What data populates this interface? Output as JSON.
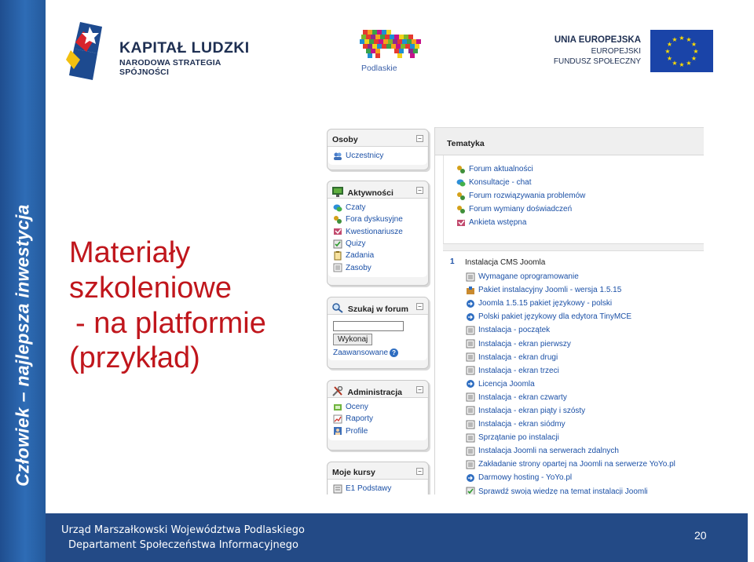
{
  "slide": {
    "vertical_slogan": "Człowiek – najlepsza inwestycja",
    "title_lines": [
      "Materiały",
      "szkoleniowe",
      "- na platformie",
      "(przykład)"
    ],
    "page_number": "20"
  },
  "logos": {
    "kapital": {
      "title": "KAPITAŁ LUDZKI",
      "subtitle": "NARODOWA STRATEGIA SPÓJNOŚCI"
    },
    "region": {
      "label": "Podlaskie"
    },
    "eu": {
      "line1": "UNIA EUROPEJSKA",
      "line2": "EUROPEJSKI",
      "line3": "FUNDUSZ SPOŁECZNY"
    }
  },
  "footer": {
    "line1": "Urząd Marszałkowski Województwa Podlaskiego",
    "line2": "Departament Społeczeństwa Informacyjnego"
  },
  "moodle": {
    "people": {
      "title": "Osoby",
      "items": [
        {
          "label": "Uczestnicy",
          "icon": "users-icon"
        }
      ]
    },
    "activities": {
      "title": "Aktywności",
      "items": [
        {
          "label": "Czaty",
          "icon": "chat-icon"
        },
        {
          "label": "Fora dyskusyjne",
          "icon": "forum-icon"
        },
        {
          "label": "Kwestionariusze",
          "icon": "questionnaire-icon"
        },
        {
          "label": "Quizy",
          "icon": "quiz-icon"
        },
        {
          "label": "Zadania",
          "icon": "assignment-icon"
        },
        {
          "label": "Zasoby",
          "icon": "resource-icon"
        }
      ]
    },
    "search": {
      "title": "Szukaj w forum",
      "button": "Wykonaj",
      "advanced": "Zaawansowane",
      "query": ""
    },
    "admin": {
      "title": "Administracja",
      "items": [
        {
          "label": "Oceny",
          "icon": "grades-icon"
        },
        {
          "label": "Raporty",
          "icon": "reports-icon"
        },
        {
          "label": "Profile",
          "icon": "profile-icon"
        }
      ]
    },
    "courses": {
      "title": "Moje kursy",
      "items": [
        {
          "label": "E1 Podstawy",
          "icon": "course-icon"
        }
      ]
    },
    "topics": {
      "title": "Tematyka",
      "items": [
        {
          "label": "Forum aktualności",
          "icon": "forum-icon"
        },
        {
          "label": "Konsultacje - chat",
          "icon": "chat-icon"
        },
        {
          "label": "Forum rozwiązywania problemów",
          "icon": "forum-icon"
        },
        {
          "label": "Forum wymiany doświadczeń",
          "icon": "forum-icon"
        },
        {
          "label": "Ankieta wstępna",
          "icon": "survey-icon"
        }
      ]
    },
    "section1": {
      "number": "1",
      "title": "Instalacja CMS Joomla",
      "items": [
        {
          "label": "Wymagane oprogramowanie",
          "icon": "page-icon"
        },
        {
          "label": "Pakiet instalacyjny Joomli - wersja 1.5.15",
          "icon": "package-icon"
        },
        {
          "label": "Joomla 1.5.15 pakiet językowy - polski",
          "icon": "link-icon"
        },
        {
          "label": "Polski pakiet językowy dla edytora TinyMCE",
          "icon": "link-icon"
        },
        {
          "label": "Instalacja - początek",
          "icon": "page-icon"
        },
        {
          "label": "Instalacja - ekran pierwszy",
          "icon": "page-icon"
        },
        {
          "label": "Instalacja - ekran drugi",
          "icon": "page-icon"
        },
        {
          "label": "Instalacja - ekran trzeci",
          "icon": "page-icon"
        },
        {
          "label": "Licencja Joomla",
          "icon": "link-icon"
        },
        {
          "label": "Instalacja - ekran czwarty",
          "icon": "page-icon"
        },
        {
          "label": "Instalacja - ekran piąty i szósty",
          "icon": "page-icon"
        },
        {
          "label": "Instalacja - ekran siódmy",
          "icon": "page-icon"
        },
        {
          "label": "Sprzątanie po instalacji",
          "icon": "page-icon"
        },
        {
          "label": "Instalacja Joomli na serwerach zdalnych",
          "icon": "page-icon"
        },
        {
          "label": "Zakładanie strony opartej na Joomli na serwerze YoYo.pl",
          "icon": "page-icon"
        },
        {
          "label": "Darmowy hosting - YoYo.pl",
          "icon": "link-icon"
        },
        {
          "label": "Sprawdź swoją wiedzę na temat instalacji Joomli",
          "icon": "quiz-icon"
        }
      ]
    }
  },
  "colors": {
    "title_red": "#c0161c",
    "band_blue": "#2e6cb6",
    "footer_blue": "#234a86",
    "link_blue": "#1b50a6"
  }
}
